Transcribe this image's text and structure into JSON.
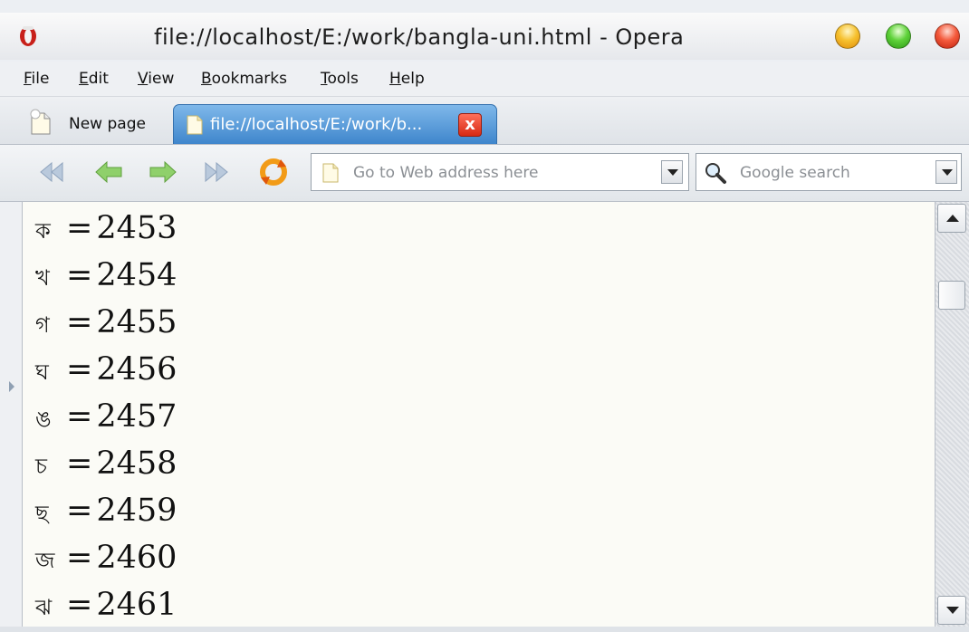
{
  "window": {
    "title": "file://localhost/E:/work/bangla-uni.html - Opera"
  },
  "menu": {
    "items": [
      {
        "label": "File",
        "mnemonic": "F",
        "rest": "ile"
      },
      {
        "label": "Edit",
        "mnemonic": "E",
        "rest": "dit"
      },
      {
        "label": "View",
        "mnemonic": "V",
        "rest": "iew"
      },
      {
        "label": "Bookmarks",
        "mnemonic": "B",
        "rest": "ookmarks"
      },
      {
        "label": "Tools",
        "mnemonic": "T",
        "rest": "ools"
      },
      {
        "label": "Help",
        "mnemonic": "H",
        "rest": "elp"
      }
    ]
  },
  "tabs": {
    "new_page_label": "New page",
    "active_label": "file://localhost/E:/work/b...",
    "close_glyph": "x"
  },
  "toolbar": {
    "address_placeholder": "Go to Web address here",
    "search_placeholder": "Google search",
    "icons": [
      "rewind-icon",
      "back-icon",
      "forward-icon",
      "fast-forward-icon",
      "reload-icon"
    ]
  },
  "colors": {
    "tab_active": "#3f86cc",
    "content_bg": "#fbfbf6",
    "nav_arrow": "#7fc45a"
  },
  "content": {
    "lines": [
      {
        "char": "ক",
        "sep": "=",
        "code": "2453"
      },
      {
        "char": "খ",
        "sep": "=",
        "code": "2454"
      },
      {
        "char": "গ",
        "sep": "=",
        "code": "2455"
      },
      {
        "char": "ঘ",
        "sep": "=",
        "code": "2456"
      },
      {
        "char": "ঙ",
        "sep": "=",
        "code": "2457"
      },
      {
        "char": "চ",
        "sep": "=",
        "code": "2458"
      },
      {
        "char": "ছ",
        "sep": "=",
        "code": "2459"
      },
      {
        "char": "জ",
        "sep": "=",
        "code": "2460"
      },
      {
        "char": "ঝ",
        "sep": "=",
        "code": "2461"
      }
    ]
  }
}
